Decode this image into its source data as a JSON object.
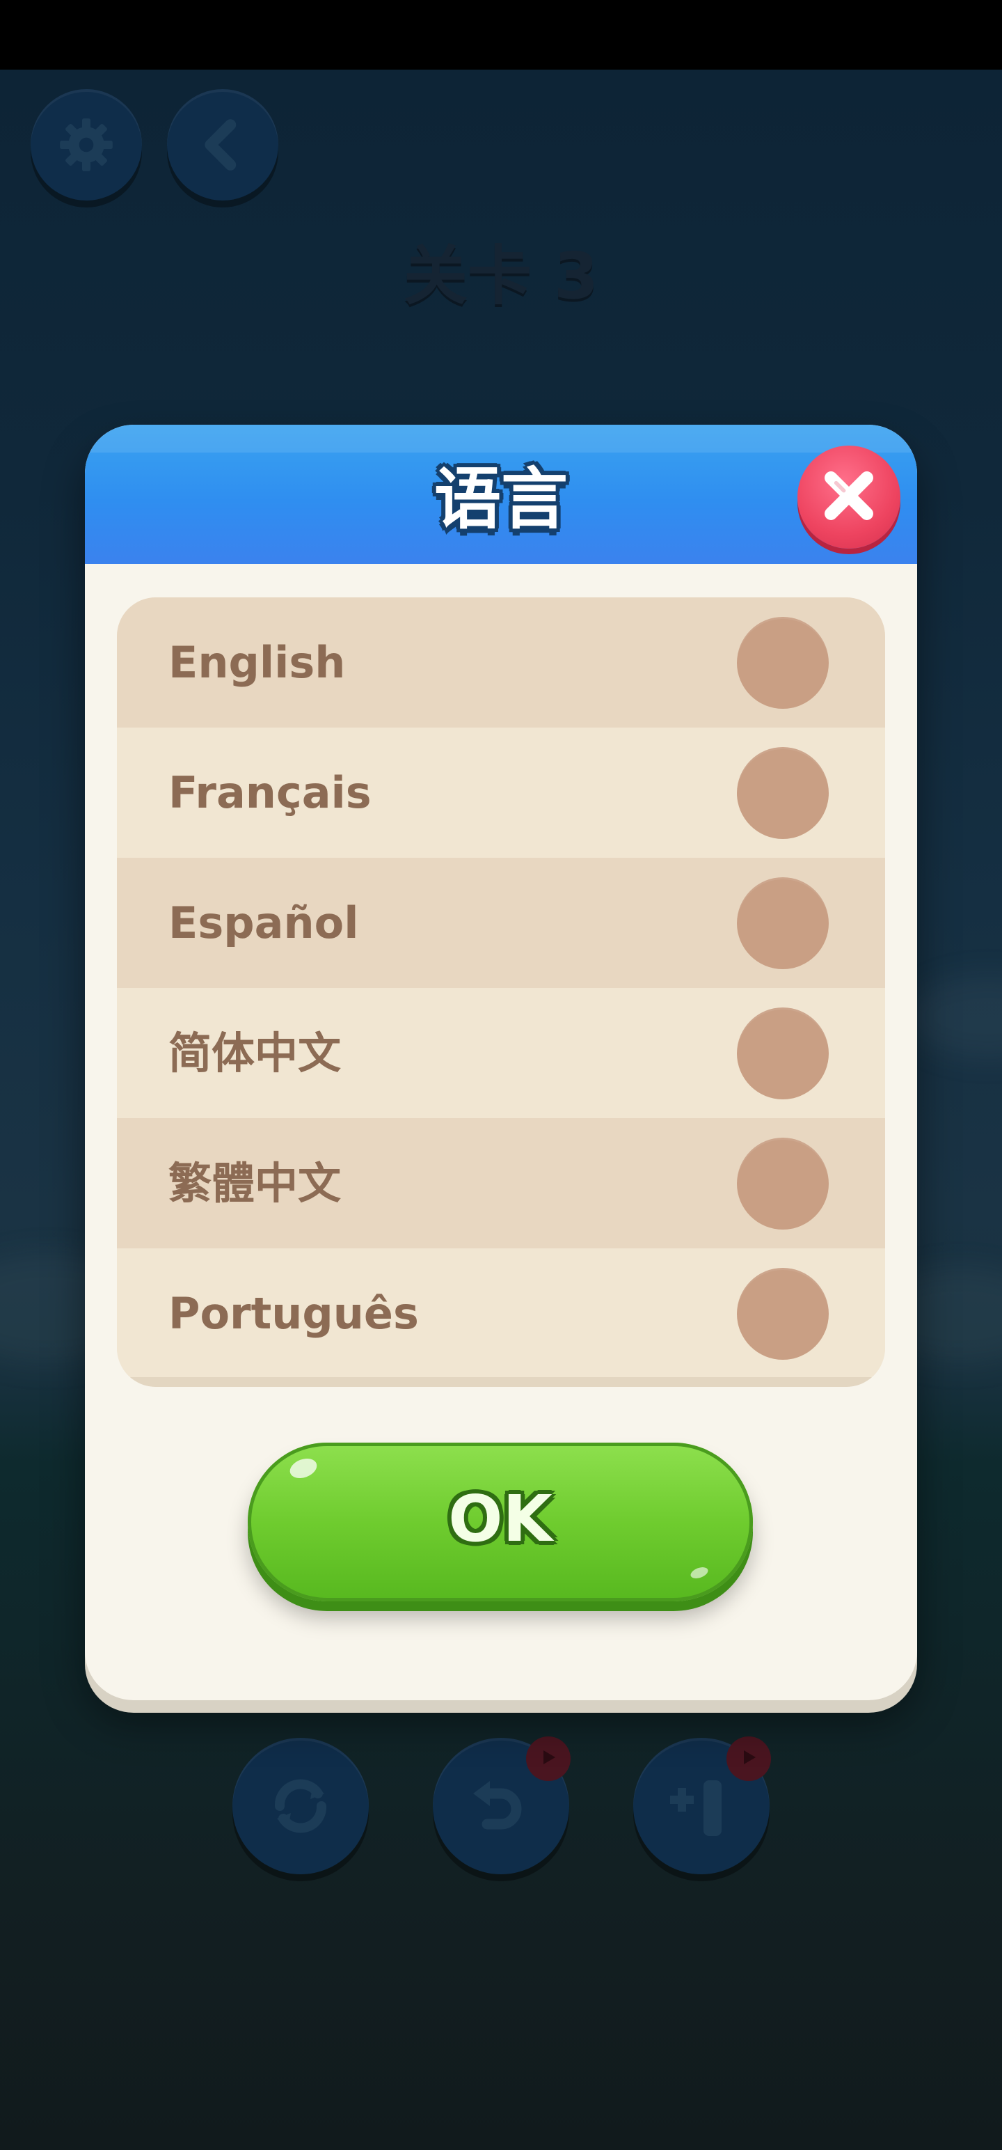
{
  "background": {
    "level_title": "关卡 3",
    "top_buttons": [
      {
        "icon": "gear-icon"
      },
      {
        "icon": "back-arrow-icon"
      }
    ],
    "bottom_buttons": [
      {
        "icon": "refresh-icon"
      },
      {
        "icon": "undo-icon",
        "badge_icon": "play-video-icon"
      },
      {
        "icon": "add-tube-icon",
        "badge_icon": "play-video-icon"
      }
    ]
  },
  "dialog": {
    "title": "语言",
    "close_icon": "close-icon",
    "languages": [
      {
        "label": "English",
        "selected": false
      },
      {
        "label": "Français",
        "selected": false
      },
      {
        "label": "Español",
        "selected": false
      },
      {
        "label": "简体中文",
        "selected": false
      },
      {
        "label": "繁體中文",
        "selected": false
      },
      {
        "label": "Português",
        "selected": false
      }
    ],
    "ok_label": "OK"
  },
  "colors": {
    "header_blue": "#3b8fef",
    "close_red": "#ee4460",
    "ok_green": "#6fcc2f",
    "label_brown": "#8c6b54",
    "radio_tan": "#c99f84"
  }
}
